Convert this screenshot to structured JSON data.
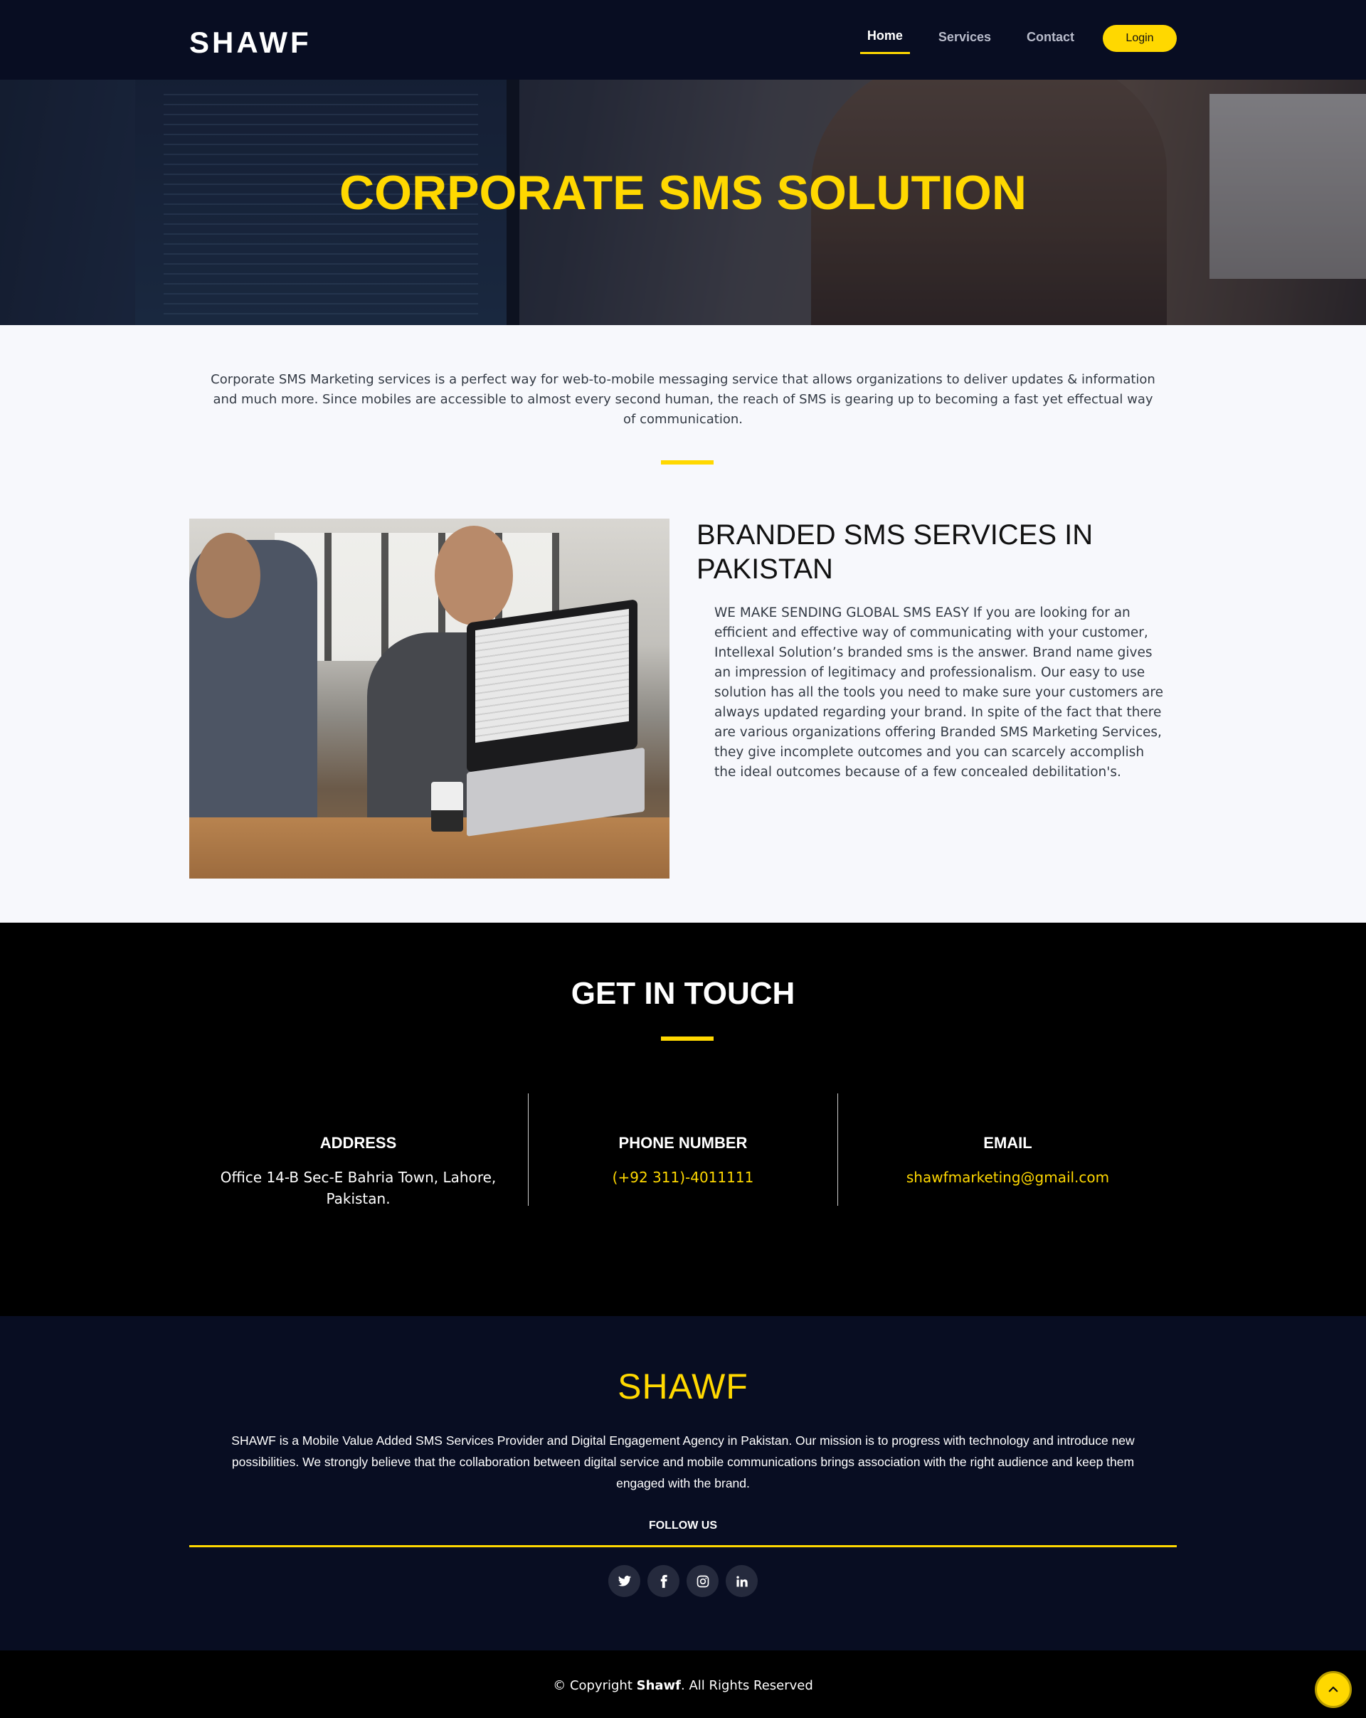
{
  "header": {
    "logo": "SHAWF",
    "nav": [
      {
        "label": "Home",
        "active": true
      },
      {
        "label": "Services",
        "active": false
      },
      {
        "label": "Contact",
        "active": false
      }
    ],
    "login_label": "Login"
  },
  "hero": {
    "title": "CORPORATE SMS SOLUTION"
  },
  "intro": {
    "text": "Corporate SMS Marketing services is a perfect way for web-to-mobile messaging service that allows organizations to deliver updates & information and much more. Since mobiles are accessible to almost every second human, the reach of SMS is gearing up to becoming a fast yet effectual way of communication."
  },
  "branded": {
    "title": "BRANDED SMS SERVICES IN PAKISTAN",
    "text": "WE MAKE SENDING GLOBAL SMS EASY If you are looking for an efficient and effective way of communicating with your customer, Intellexal Solution’s branded sms is the answer. Brand name gives an impression of legitimacy and professionalism. Our easy to use solution has all the tools you need to make sure your customers are always updated regarding your brand. In spite of the fact that there are various organizations offering Branded SMS Marketing Services, they give incomplete outcomes and you can scarcely accomplish the ideal outcomes because of a few concealed debilitation's."
  },
  "touch": {
    "title": "GET IN TOUCH",
    "address": {
      "heading": "ADDRESS",
      "value": "Office 14-B Sec-E Bahria Town, Lahore, Pakistan."
    },
    "phone": {
      "heading": "PHONE NUMBER",
      "value": "(+92 311)-4011111"
    },
    "email": {
      "heading": "EMAIL",
      "value": "shawfmarketing@gmail.com"
    }
  },
  "footer": {
    "logo": "SHAWF",
    "text": "SHAWF is a Mobile Value Added SMS Services Provider and Digital Engagement Agency in Pakistan. Our mission is to progress with technology and introduce new possibilities. We strongly believe that the collaboration between digital service and mobile communications brings association with the right audience and keep them engaged with the brand.",
    "follow_label": "FOLLOW US",
    "socials": [
      "twitter-icon",
      "facebook-icon",
      "instagram-icon",
      "linkedin-icon"
    ],
    "copyright_prefix": "© Copyright ",
    "copyright_brand": "Shawf",
    "copyright_suffix": ". All Rights Reserved"
  },
  "colors": {
    "accent": "#ffd800",
    "header_bg": "#080d22",
    "touch_bg": "#000000"
  }
}
